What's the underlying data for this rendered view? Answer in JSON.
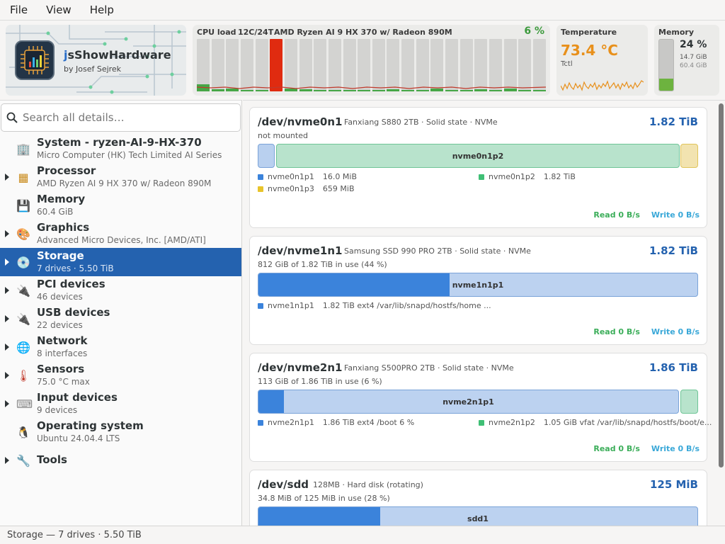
{
  "menu": [
    "File",
    "View",
    "Help"
  ],
  "app": {
    "name_first": "j",
    "name_rest": "sShowHardware",
    "author": "by Josef Sejrek"
  },
  "cpu": {
    "title": "CPU load",
    "threads": "12C/24T",
    "model": "AMD Ryzen AI 9 HX 370 w/ Radeon 890M",
    "percent": "6 %",
    "loads": [
      0.14,
      0.04,
      0.05,
      0.03,
      0.02,
      1.0,
      0.05,
      0.04,
      0.03,
      0.02,
      0.03,
      0.02,
      0.03,
      0.04,
      0.03,
      0.02,
      0.05,
      0.03,
      0.02,
      0.04,
      0.03,
      0.05,
      0.02,
      0.03
    ]
  },
  "temperature": {
    "title": "Temperature",
    "value": "73.4 °C",
    "sensor": "Tctl"
  },
  "memory": {
    "title": "Memory",
    "percent": "24 %",
    "used": "14.7 GiB",
    "total": "60.4 GiB",
    "fraction": 0.24
  },
  "search": {
    "placeholder": "Search all details…"
  },
  "sidebar": {
    "items": [
      {
        "label": "System - ryzen-AI-9-HX-370",
        "sub": "Micro Computer (HK) Tech Limited AI Series",
        "icon": "building-icon",
        "expandable": false
      },
      {
        "label": "Processor",
        "sub": "AMD Ryzen AI 9 HX 370 w/ Radeon 890M",
        "icon": "chip-icon",
        "expandable": true
      },
      {
        "label": "Memory",
        "sub": "60.4 GiB",
        "icon": "floppy-icon",
        "expandable": false
      },
      {
        "label": "Graphics",
        "sub": "Advanced Micro Devices, Inc. [AMD/ATI]",
        "icon": "palette-icon",
        "expandable": true
      },
      {
        "label": "Storage",
        "sub": "7 drives  ·  5.50 TiB",
        "icon": "disc-icon",
        "expandable": true,
        "selected": true
      },
      {
        "label": "PCI devices",
        "sub": "46 devices",
        "icon": "plug-icon",
        "expandable": true
      },
      {
        "label": "USB devices",
        "sub": "22 devices",
        "icon": "usb-plug-icon",
        "expandable": true
      },
      {
        "label": "Network",
        "sub": "8 interfaces",
        "icon": "globe-icon",
        "expandable": true
      },
      {
        "label": "Sensors",
        "sub": "75.0 °C max",
        "icon": "thermometer-icon",
        "expandable": true
      },
      {
        "label": "Input devices",
        "sub": "9 devices",
        "icon": "keyboard-icon",
        "expandable": true
      },
      {
        "label": "Operating system",
        "sub": "Ubuntu 24.04.4 LTS",
        "icon": "penguin-icon",
        "expandable": false
      },
      {
        "label": "Tools",
        "sub": "",
        "icon": "wrench-icon",
        "expandable": true
      }
    ]
  },
  "drives": [
    {
      "name": "/dev/nvme0n1",
      "model": "Fanxiang S880 2TB  ·  Solid state  ·  NVMe",
      "size": "1.82 TiB",
      "usage": "not mounted",
      "partitions": [
        {
          "label": "",
          "color": "#b9d0ef",
          "border": "#7aa3d8",
          "used": 0
        },
        {
          "label": "nvme0n1p2",
          "color": "#b8e3cc",
          "border": "#6fc597",
          "used": 0
        },
        {
          "label": "",
          "color": "#f2e3b0",
          "border": "#e0c45a",
          "used": 0
        }
      ],
      "legend": [
        {
          "name": "nvme0n1p1",
          "info": "16.0 MiB",
          "color": "#3b83db"
        },
        {
          "name": "nvme0n1p2",
          "info": "1.82 TiB",
          "color": "#3fbf75"
        },
        {
          "name": "nvme0n1p3",
          "info": "659 MiB",
          "color": "#e8c42b"
        }
      ],
      "read": "Read  0 B/s",
      "write": "Write  0 B/s"
    },
    {
      "name": "/dev/nvme1n1",
      "model": "Samsung SSD 990 PRO 2TB  ·  Solid state  ·  NVMe",
      "size": "1.82 TiB",
      "usage": "812 GiB of 1.82 TiB in use  (44 %)",
      "partitions": [
        {
          "label": "nvme1n1p1",
          "color": "#bcd2f0",
          "border": "#7aa3d8",
          "used": 0.435
        }
      ],
      "legend": [
        {
          "name": "nvme1n1p1",
          "info": "1.82 TiB    ext4    /var/lib/snapd/hostfs/home ...",
          "color": "#3b83db"
        }
      ],
      "read": "Read  0 B/s",
      "write": "Write  0 B/s"
    },
    {
      "name": "/dev/nvme2n1",
      "model": "Fanxiang S500PRO 2TB  ·  Solid state  ·  NVMe",
      "size": "1.86 TiB",
      "usage": "113 GiB of 1.86 TiB in use  (6 %)",
      "partitions": [
        {
          "label": "nvme2n1p1",
          "color": "#bcd2f0",
          "border": "#7aa3d8",
          "used": 0.06
        },
        {
          "label": "",
          "color": "#b8e3cc",
          "border": "#6fc597",
          "used": 0
        }
      ],
      "legend": [
        {
          "name": "nvme2n1p1",
          "info": "1.86 TiB    ext4    /boot    6 %",
          "color": "#3b83db"
        },
        {
          "name": "nvme2n1p2",
          "info": "1.05 GiB    vfat    /var/lib/snapd/hostfs/boot/e...",
          "color": "#3fbf75"
        }
      ],
      "read": "Read  0 B/s",
      "write": "Write  0 B/s"
    },
    {
      "name": "/dev/sdd",
      "model": "128MB  ·  Hard disk (rotating)",
      "size": "125 MiB",
      "usage": "34.8 MiB of 125 MiB in use  (28 %)",
      "partitions": [
        {
          "label": "sdd1",
          "color": "#bcd2f0",
          "border": "#7aa3d8",
          "used": 0.278
        }
      ],
      "legend": [],
      "read": "",
      "write": ""
    }
  ],
  "status": "Storage  —  7 drives  ·  5.50 TiB"
}
